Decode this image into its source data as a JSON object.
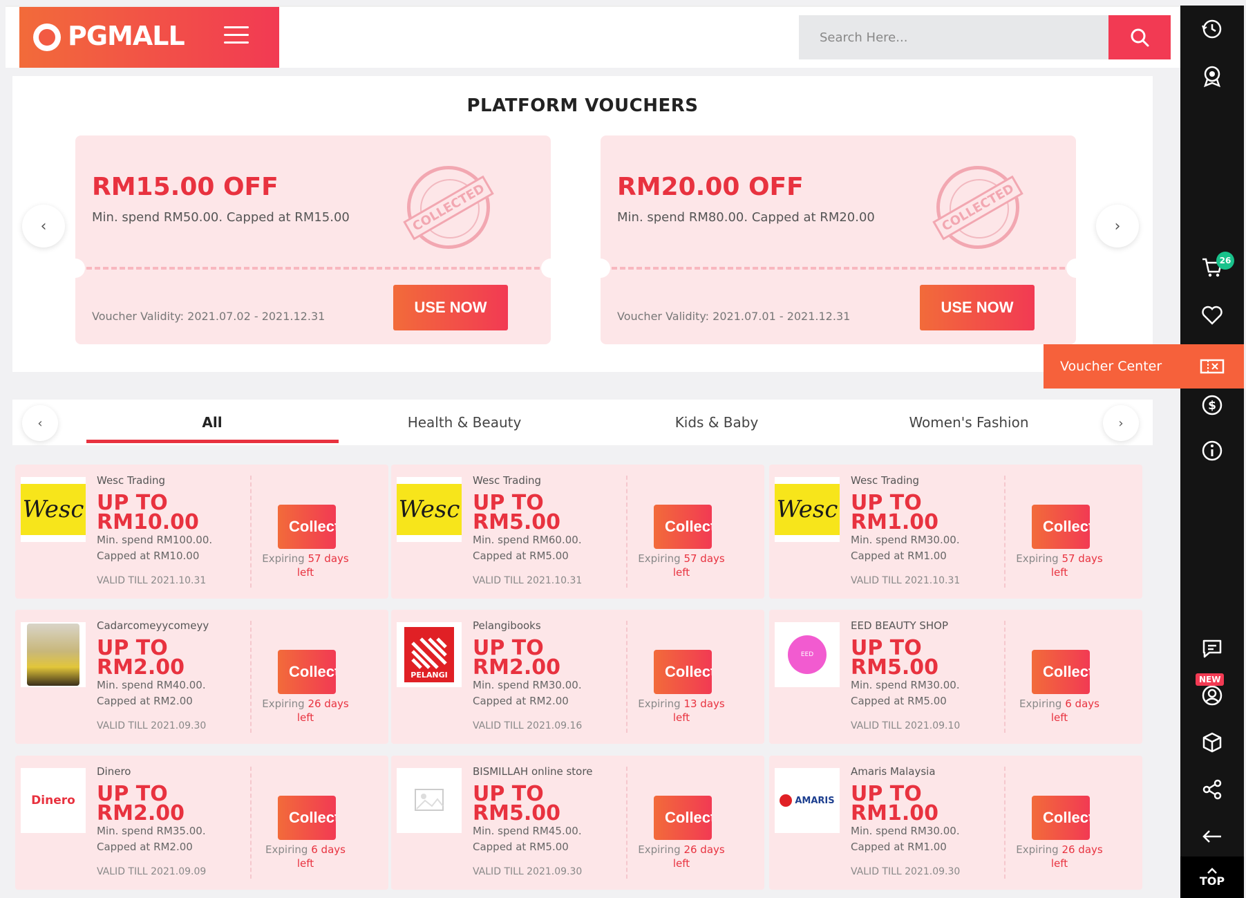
{
  "header": {
    "logo_text": "PGMALL",
    "search_placeholder": "Search Here..."
  },
  "platform_vouchers": {
    "title": "PLATFORM VOUCHERS",
    "vouchers": [
      {
        "amount": "RM15.00 OFF",
        "condition": "Min. spend RM50.00. Capped at RM15.00",
        "stamp": "COLLECTED",
        "validity": "Voucher Validity: 2021.07.02 - 2021.12.31",
        "button": "USE NOW"
      },
      {
        "amount": "RM20.00 OFF",
        "condition": "Min. spend RM80.00. Capped at RM20.00",
        "stamp": "COLLECTED",
        "validity": "Voucher Validity: 2021.07.01 - 2021.12.31",
        "button": "USE NOW"
      }
    ]
  },
  "tabs": [
    "All",
    "Health & Beauty",
    "Kids & Baby",
    "Women's Fashion"
  ],
  "active_tab": "All",
  "shop_vouchers": [
    {
      "shop": "Wesc Trading",
      "amount": "UP TO RM10.00",
      "min": "Min. spend RM100.00.",
      "cap": "Capped at RM10.00",
      "valid": "VALID TILL 2021.10.31",
      "button": "Collect",
      "exp_pre": "Expiring",
      "exp_days": "57 days",
      "exp_post": "left",
      "logo": "wesc"
    },
    {
      "shop": "Wesc Trading",
      "amount": "UP TO RM5.00",
      "min": "Min. spend RM60.00.",
      "cap": "Capped at RM5.00",
      "valid": "VALID TILL 2021.10.31",
      "button": "Collect",
      "exp_pre": "Expiring",
      "exp_days": "57 days",
      "exp_post": "left",
      "logo": "wesc"
    },
    {
      "shop": "Wesc Trading",
      "amount": "UP TO RM1.00",
      "min": "Min. spend RM30.00.",
      "cap": "Capped at RM1.00",
      "valid": "VALID TILL 2021.10.31",
      "button": "Collect",
      "exp_pre": "Expiring",
      "exp_days": "57 days",
      "exp_post": "left",
      "logo": "wesc"
    },
    {
      "shop": "Cadarcomeyycomeyy",
      "amount": "UP TO RM2.00",
      "min": "Min. spend RM40.00.",
      "cap": "Capped at RM2.00",
      "valid": "VALID TILL 2021.09.30",
      "button": "Collect",
      "exp_pre": "Expiring",
      "exp_days": "26 days",
      "exp_post": "left",
      "logo": "food"
    },
    {
      "shop": "Pelangibooks",
      "amount": "UP TO RM2.00",
      "min": "Min. spend RM30.00.",
      "cap": "Capped at RM2.00",
      "valid": "VALID TILL 2021.09.16",
      "button": "Collect",
      "exp_pre": "Expiring",
      "exp_days": "13 days",
      "exp_post": "left",
      "logo": "pelangi"
    },
    {
      "shop": "EED BEAUTY SHOP",
      "amount": "UP TO RM5.00",
      "min": "Min. spend RM30.00.",
      "cap": "Capped at RM5.00",
      "valid": "VALID TILL 2021.09.10",
      "button": "Collect",
      "exp_pre": "Expiring",
      "exp_days": "6 days",
      "exp_post": "left",
      "logo": "eed"
    },
    {
      "shop": "Dinero",
      "amount": "UP TO RM2.00",
      "min": "Min. spend RM35.00.",
      "cap": "Capped at RM2.00",
      "valid": "VALID TILL 2021.09.09",
      "button": "Collect",
      "exp_pre": "Expiring",
      "exp_days": "6 days",
      "exp_post": "left",
      "logo": "dinero"
    },
    {
      "shop": "BISMILLAH online store",
      "amount": "UP TO RM5.00",
      "min": "Min. spend RM45.00.",
      "cap": "Capped at RM5.00",
      "valid": "VALID TILL 2021.09.30",
      "button": "Collect",
      "exp_pre": "Expiring",
      "exp_days": "26 days",
      "exp_post": "left",
      "logo": "noimage"
    },
    {
      "shop": "Amaris Malaysia",
      "amount": "UP TO RM1.00",
      "min": "Min. spend RM30.00.",
      "cap": "Capped at RM1.00",
      "valid": "VALID TILL 2021.09.30",
      "button": "Collect",
      "exp_pre": "Expiring",
      "exp_days": "26 days",
      "exp_post": "left",
      "logo": "amaris"
    }
  ],
  "logo_texts": {
    "wesc": "Wesc",
    "pelangi": "PELANGI",
    "eed": "EED",
    "dinero": "Dinero",
    "amaris": "AMARIS"
  },
  "sidebar": {
    "cart_count": "26",
    "voucher_center_label": "Voucher Center",
    "new_badge": "NEW",
    "top_label": "TOP",
    "icons": [
      "history-icon",
      "award-icon",
      "cart-icon",
      "heart-icon",
      "voucher-icon",
      "dollar-icon",
      "info-icon",
      "chat-icon",
      "user-icon",
      "box-icon",
      "share-icon",
      "back-arrow-icon"
    ]
  },
  "colors": {
    "brand_red": "#f23a53",
    "brand_orange": "#f26b3a",
    "voucher_bg": "#fde6e8",
    "rail_bg": "#141414"
  }
}
